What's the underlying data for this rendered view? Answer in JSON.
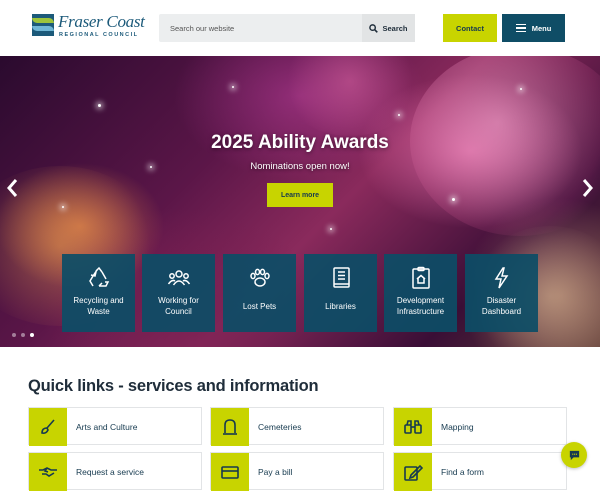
{
  "header": {
    "logo_line1": "Fraser Coast",
    "logo_line2": "REGIONAL COUNCIL",
    "search_placeholder": "Search our website",
    "search_button": "Search",
    "contact_button": "Contact",
    "menu_button": "Menu"
  },
  "hero": {
    "title": "2025 Ability Awards",
    "subtitle": "Nominations open now!",
    "cta": "Learn more",
    "slide_dots": 3,
    "active_dot": 3
  },
  "tiles": [
    {
      "label": "Recycling and Waste",
      "icon": "recycle-icon"
    },
    {
      "label": "Working for Council",
      "icon": "people-icon"
    },
    {
      "label": "Lost Pets",
      "icon": "paw-icon"
    },
    {
      "label": "Libraries",
      "icon": "book-icon"
    },
    {
      "label": "Development Infrastructure",
      "icon": "clipboard-house-icon"
    },
    {
      "label": "Disaster Dashboard",
      "icon": "lightning-icon"
    }
  ],
  "quick_links": {
    "title": "Quick links - services and information",
    "items": [
      {
        "label": "Arts and Culture",
        "icon": "paintbrush-icon"
      },
      {
        "label": "Cemeteries",
        "icon": "headstone-icon"
      },
      {
        "label": "Mapping",
        "icon": "binoculars-icon"
      },
      {
        "label": "Request a service",
        "icon": "handshake-icon"
      },
      {
        "label": "Pay a bill",
        "icon": "credit-card-icon"
      },
      {
        "label": "Find a form",
        "icon": "pencil-form-icon"
      }
    ]
  },
  "colors": {
    "brand_blue": "#0f4d66",
    "brand_lime": "#c8d400"
  }
}
